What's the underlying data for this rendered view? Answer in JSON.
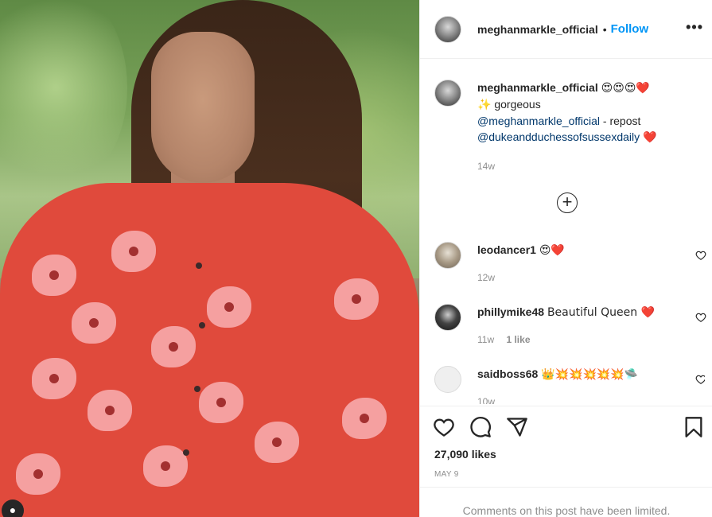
{
  "post": {
    "username": "meghanmarkle_official",
    "follow_label": "Follow",
    "separator": "•",
    "more_label": "•••"
  },
  "caption": {
    "username": "meghanmarkle_official",
    "emojis_line1": "😍😍😍❤️",
    "sparkle": "✨",
    "text_line2": "gorgeous",
    "mention1": "@meghanmarkle_official",
    "repost_text": " - repost",
    "mention2": "@dukeandduchessofsussexdaily",
    "heart": "❤️",
    "time": "14w"
  },
  "load_more_label": "+",
  "comments": [
    {
      "username": "leodancer1",
      "text": "😍❤️",
      "time": "12w",
      "likes": ""
    },
    {
      "username": "phillymike48",
      "text": "Beautiful Queen ❤️",
      "time": "11w",
      "likes": "1 like"
    },
    {
      "username": "saidboss68",
      "text": "👑💥💥💥💥💥🛸",
      "time": "10w",
      "likes": ""
    }
  ],
  "actions": {
    "likes": "27,090 likes",
    "date": "MAY 9",
    "limited_text": "Comments on this post have been limited."
  },
  "colors": {
    "accent": "#0095f6",
    "link": "#00376b",
    "muted": "#8e8e8e",
    "divider": "#efefef",
    "shirt": "#e04a3c"
  }
}
